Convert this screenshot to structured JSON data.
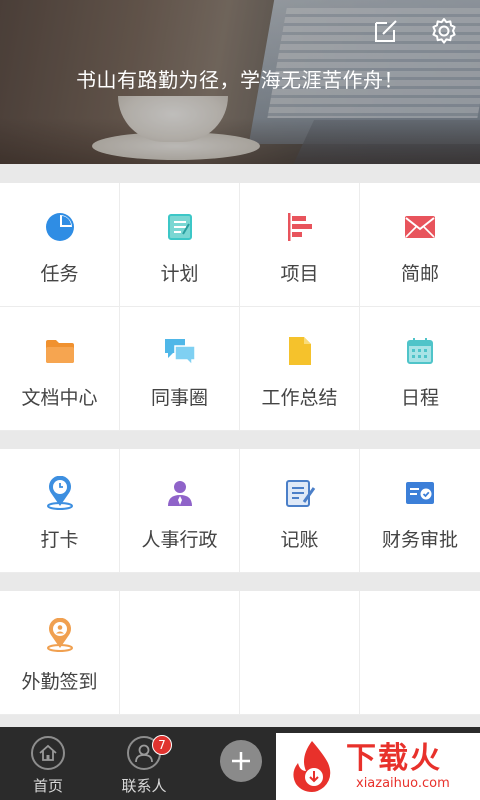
{
  "header": {
    "slogan": "书山有路勤为径，学海无涯苦作舟！"
  },
  "sections": [
    {
      "rows": [
        [
          {
            "label": "任务",
            "icon": "pie-chart-icon",
            "color": "#2f8de4"
          },
          {
            "label": "计划",
            "icon": "plan-note-icon",
            "color": "#3cc7c7"
          },
          {
            "label": "项目",
            "icon": "project-bars-icon",
            "color": "#e8545c"
          },
          {
            "label": "简邮",
            "icon": "mail-icon",
            "color": "#e8545c"
          }
        ],
        [
          {
            "label": "文档中心",
            "icon": "folder-icon",
            "color": "#f0912f"
          },
          {
            "label": "同事圈",
            "icon": "chat-bubbles-icon",
            "color": "#4fb7e8"
          },
          {
            "label": "工作总结",
            "icon": "document-icon",
            "color": "#f5c22c"
          },
          {
            "label": "日程",
            "icon": "calendar-icon",
            "color": "#4fc4c9"
          }
        ]
      ]
    },
    {
      "rows": [
        [
          {
            "label": "打卡",
            "icon": "location-clock-icon",
            "color": "#3d8fe0"
          },
          {
            "label": "人事行政",
            "icon": "person-icon",
            "color": "#8f63c9"
          },
          {
            "label": "记账",
            "icon": "bookkeeping-icon",
            "color": "#4b7fc8"
          },
          {
            "label": "财务审批",
            "icon": "approval-card-icon",
            "color": "#3c7fd8"
          }
        ]
      ]
    },
    {
      "rows": [
        [
          {
            "label": "外勤签到",
            "icon": "field-checkin-icon",
            "color": "#f0a050"
          }
        ]
      ]
    }
  ],
  "nav": {
    "home_label": "首页",
    "contacts_label": "联系人",
    "contacts_badge": "7"
  },
  "watermark": {
    "brand": "下载火",
    "domain": "xiazaihuo.com"
  }
}
